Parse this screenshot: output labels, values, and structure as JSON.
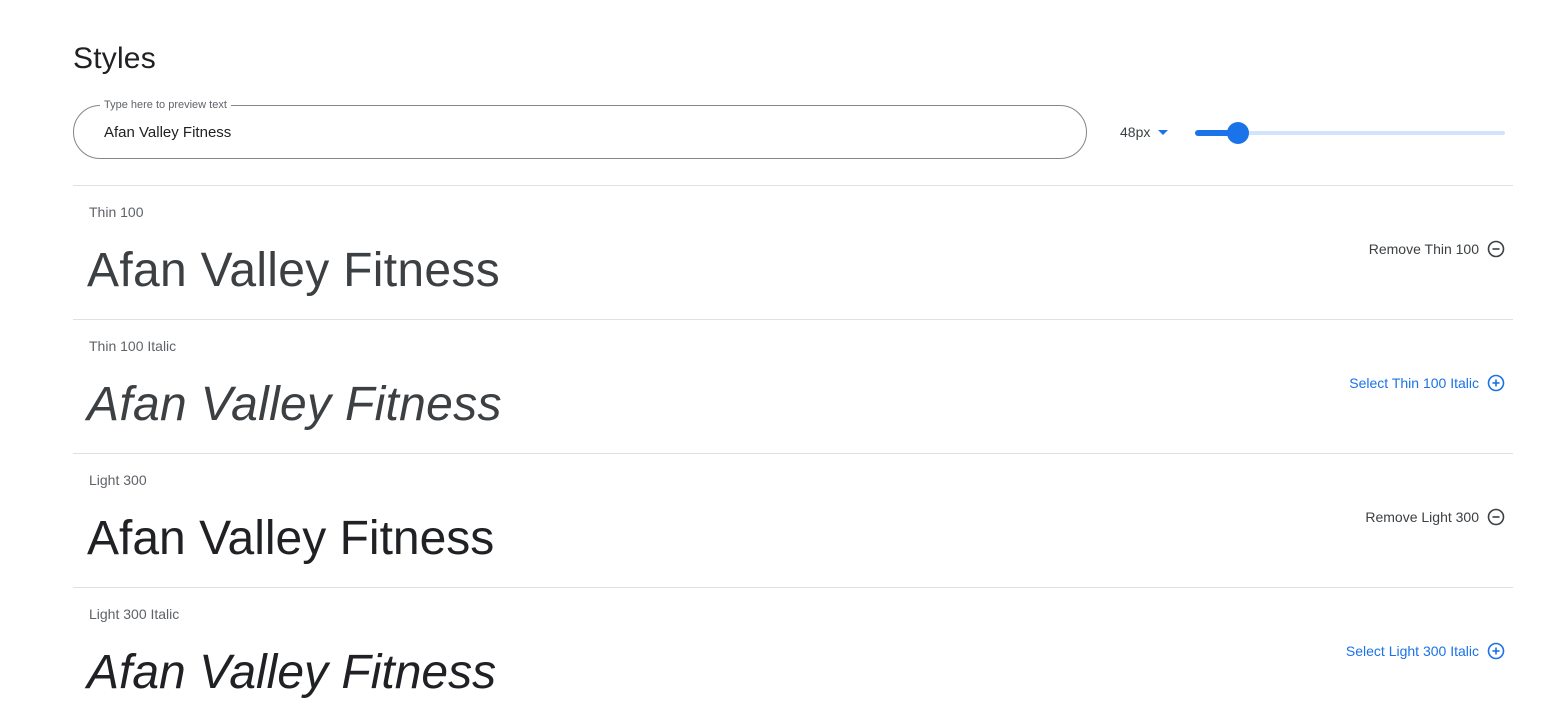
{
  "section": {
    "title": "Styles"
  },
  "preview": {
    "legend": "Type here to preview text",
    "value": "Afan Valley Fitness"
  },
  "size": {
    "label": "48px",
    "slider_fraction": 0.14
  },
  "colors": {
    "accent": "#1a73e8",
    "track": "#d2e3fc",
    "divider": "#e0e0e0",
    "text": "#202124",
    "muted": "#5f6368"
  },
  "styles": [
    {
      "label": "Thin 100",
      "sample": "Afan Valley Fitness",
      "action": "Remove Thin 100",
      "icon": "minus-circle-icon"
    },
    {
      "label": "Thin 100 Italic",
      "sample": "Afan Valley Fitness",
      "action": "Select Thin 100 Italic",
      "icon": "plus-circle-icon"
    },
    {
      "label": "Light 300",
      "sample": "Afan Valley Fitness",
      "action": "Remove Light 300",
      "icon": "minus-circle-icon"
    },
    {
      "label": "Light 300 Italic",
      "sample": "Afan Valley Fitness",
      "action": "Select Light 300 Italic",
      "icon": "plus-circle-icon"
    }
  ]
}
